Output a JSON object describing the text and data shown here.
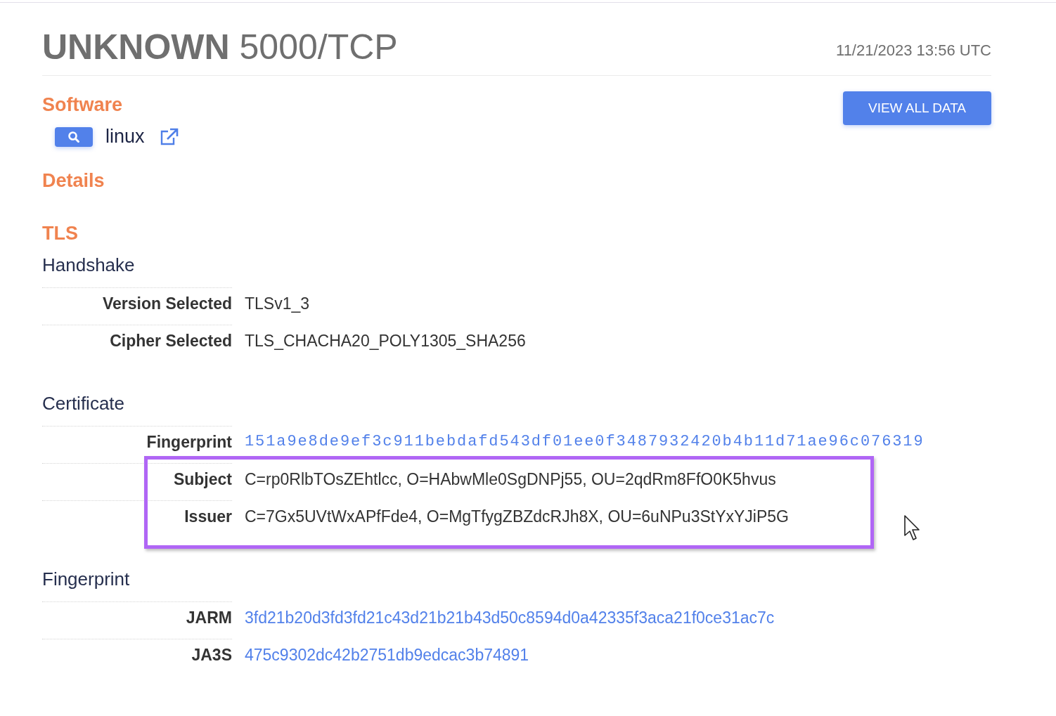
{
  "header": {
    "service": "UNKNOWN",
    "port": "5000/TCP",
    "timestamp": "11/21/2023 13:56 UTC"
  },
  "view_all_button": "VIEW ALL DATA",
  "software": {
    "title": "Software",
    "items": [
      {
        "name": "linux"
      }
    ]
  },
  "details": {
    "title": "Details"
  },
  "tls": {
    "title": "TLS",
    "sections": [
      {
        "title": "Handshake",
        "rows": [
          {
            "label": "Version Selected",
            "value": "TLSv1_3",
            "kind": "text",
            "highlighted": false
          },
          {
            "label": "Cipher Selected",
            "value": "TLS_CHACHA20_POLY1305_SHA256",
            "kind": "text",
            "highlighted": false
          }
        ]
      },
      {
        "title": "Certificate",
        "rows": [
          {
            "label": "Fingerprint",
            "value": "151a9e8de9ef3c911bebdafd543df01ee0f3487932420b4b11d71ae96c076319",
            "kind": "hash",
            "highlighted": false
          },
          {
            "label": "Subject",
            "value": "C=rp0RlbTOsZEhtlcc, O=HAbwMle0SgDNPj55, OU=2qdRm8FfO0K5hvus",
            "kind": "text",
            "highlighted": true
          },
          {
            "label": "Issuer",
            "value": "C=7Gx5UVtWxAPfFde4, O=MgTfygZBZdcRJh8X, OU=6uNPu3StYxYJiP5G",
            "kind": "text",
            "highlighted": true
          }
        ]
      },
      {
        "title": "Fingerprint",
        "rows": [
          {
            "label": "JARM",
            "value": "3fd21b20d3fd3fd21c43d21b21b43d50c8594d0a42335f3aca21f0ce31ac7c",
            "kind": "link",
            "highlighted": false
          },
          {
            "label": "JA3S",
            "value": "475c9302dc42b2751db9edcac3b74891",
            "kind": "link",
            "highlighted": false
          }
        ]
      }
    ]
  }
}
